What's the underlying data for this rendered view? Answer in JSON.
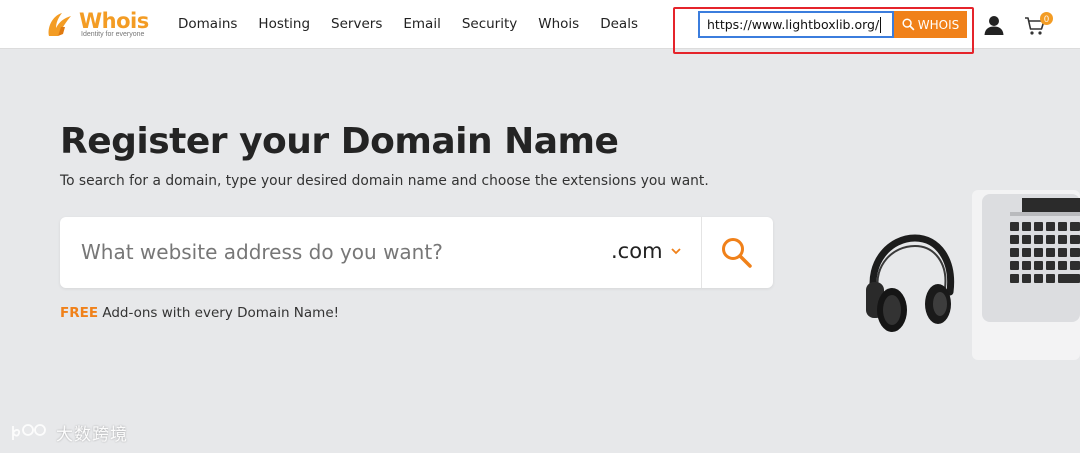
{
  "brand": {
    "name": "Whois",
    "tagline": "Identity for everyone",
    "color": "#f39c24"
  },
  "nav": {
    "items": [
      {
        "label": "Domains"
      },
      {
        "label": "Hosting"
      },
      {
        "label": "Servers"
      },
      {
        "label": "Email"
      },
      {
        "label": "Security"
      },
      {
        "label": "Whois"
      },
      {
        "label": "Deals"
      }
    ]
  },
  "whois_lookup": {
    "value": "https://www.lightboxlib.org/",
    "button_label": "WHOIS",
    "button_color": "#f0811a",
    "highlight_color": "#e5242b"
  },
  "header_icons": {
    "user": "user-icon",
    "cart": "cart-icon",
    "cart_count": "0"
  },
  "hero": {
    "title": "Register your Domain Name",
    "subtitle": "To search for a domain, type your desired domain name and choose the extensions you want.",
    "search_placeholder": "What website address do you want?",
    "extension": ".com",
    "addons_free": "FREE",
    "addons_text": " Add-ons with every Domain Name!"
  },
  "watermark": {
    "text": "大数跨境"
  }
}
